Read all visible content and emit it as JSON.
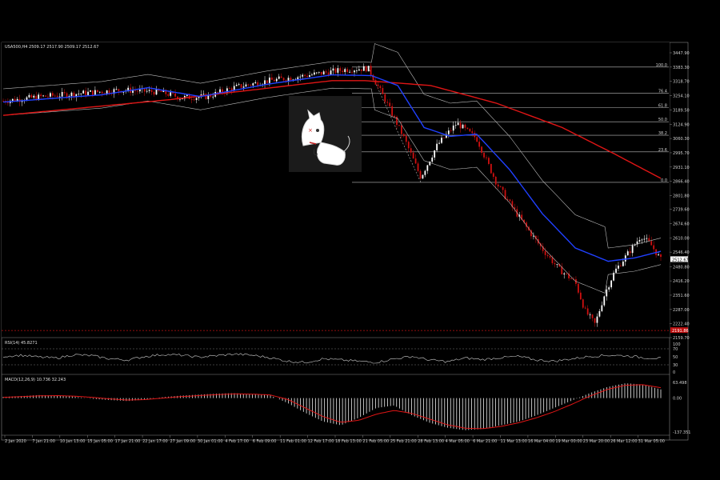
{
  "chart_data": [
    {
      "type": "candlestick",
      "symbol_header": "USA500,H4",
      "ohlc_header": "2509.17 2517.90 2509.17 2512.67",
      "price_axis_ticks": [
        3447.9,
        3383.3,
        3318.7,
        3254.1,
        3189.5,
        3124.9,
        3060.3,
        2995.7,
        2931.1,
        2866.4,
        2801.8,
        2739.6,
        2674.6,
        2610.0,
        2546.4,
        2480.8,
        2416.2,
        2351.6,
        2287.0,
        2222.4,
        2159.7
      ],
      "ylim": [
        2159.7,
        3447.9
      ],
      "current_price_label": "2512.67",
      "current_price": 2512.67,
      "low_line_label": "2191.86",
      "low_line": 2191.86,
      "fibonacci": {
        "levels": [
          {
            "label": "100.0",
            "price": 3383.3
          },
          {
            "label": "76.4",
            "price": 3265.0
          },
          {
            "label": "61.8",
            "price": 3200.0
          },
          {
            "label": "50.0",
            "price": 3136.0
          },
          {
            "label": "38.2",
            "price": 3075.0
          },
          {
            "label": "23.6",
            "price": 3000.0
          },
          {
            "label": "0.0",
            "price": 2862.0
          }
        ]
      },
      "x_axis_labels": [
        "2 Jan 2020",
        "7 Jan 21:00",
        "10 Jan 13:00",
        "15 Jan 05:00",
        "17 Jan 21:00",
        "22 Jan 17:00",
        "27 Jan 09:00",
        "30 Jan 01:00",
        "4 Feb 17:00",
        "6 Feb 09:00",
        "11 Feb 01:00",
        "12 Feb 17:00",
        "18 Feb 13:00",
        "21 Feb 05:00",
        "25 Feb 21:00",
        "28 Feb 13:00",
        "4 Mar 05:00",
        "6 Mar 21:00",
        "11 Mar 13:00",
        "16 Mar 04:00",
        "19 Mar 00:00",
        "23 Mar 20:00",
        "26 Mar 12:00",
        "31 Mar 05:00"
      ],
      "close_trajectory": [
        {
          "t": 0,
          "price": 3230
        },
        {
          "t": 0.06,
          "price": 3250
        },
        {
          "t": 0.12,
          "price": 3265
        },
        {
          "t": 0.18,
          "price": 3280
        },
        {
          "t": 0.24,
          "price": 3270
        },
        {
          "t": 0.27,
          "price": 3245
        },
        {
          "t": 0.31,
          "price": 3250
        },
        {
          "t": 0.35,
          "price": 3290
        },
        {
          "t": 0.4,
          "price": 3320
        },
        {
          "t": 0.46,
          "price": 3345
        },
        {
          "t": 0.52,
          "price": 3372
        },
        {
          "t": 0.555,
          "price": 3378
        },
        {
          "t": 0.58,
          "price": 3240
        },
        {
          "t": 0.61,
          "price": 3060
        },
        {
          "t": 0.635,
          "price": 2885
        },
        {
          "t": 0.66,
          "price": 3030
        },
        {
          "t": 0.69,
          "price": 3130
        },
        {
          "t": 0.72,
          "price": 3060
        },
        {
          "t": 0.75,
          "price": 2860
        },
        {
          "t": 0.775,
          "price": 2745
        },
        {
          "t": 0.8,
          "price": 2640
        },
        {
          "t": 0.82,
          "price": 2560
        },
        {
          "t": 0.845,
          "price": 2470
        },
        {
          "t": 0.87,
          "price": 2410
        },
        {
          "t": 0.885,
          "price": 2280
        },
        {
          "t": 0.9,
          "price": 2220
        },
        {
          "t": 0.915,
          "price": 2360
        },
        {
          "t": 0.93,
          "price": 2460
        },
        {
          "t": 0.95,
          "price": 2540
        },
        {
          "t": 0.97,
          "price": 2620
        },
        {
          "t": 0.985,
          "price": 2580
        },
        {
          "t": 1.0,
          "price": 2512
        }
      ],
      "moving_average_red": [
        {
          "t": 0,
          "price": 3165
        },
        {
          "t": 0.25,
          "price": 3235
        },
        {
          "t": 0.5,
          "price": 3322
        },
        {
          "t": 0.55,
          "price": 3322
        },
        {
          "t": 0.65,
          "price": 3300
        },
        {
          "t": 0.75,
          "price": 3220
        },
        {
          "t": 0.85,
          "price": 3110
        },
        {
          "t": 0.93,
          "price": 2990
        },
        {
          "t": 1.0,
          "price": 2880
        }
      ],
      "moving_average_blue": [
        {
          "t": 0,
          "price": 3225
        },
        {
          "t": 0.15,
          "price": 3258
        },
        {
          "t": 0.22,
          "price": 3290
        },
        {
          "t": 0.3,
          "price": 3250
        },
        {
          "t": 0.4,
          "price": 3305
        },
        {
          "t": 0.5,
          "price": 3348
        },
        {
          "t": 0.56,
          "price": 3345
        },
        {
          "t": 0.6,
          "price": 3300
        },
        {
          "t": 0.64,
          "price": 3110
        },
        {
          "t": 0.68,
          "price": 3070
        },
        {
          "t": 0.72,
          "price": 3080
        },
        {
          "t": 0.77,
          "price": 2920
        },
        {
          "t": 0.82,
          "price": 2720
        },
        {
          "t": 0.87,
          "price": 2565
        },
        {
          "t": 0.92,
          "price": 2505
        },
        {
          "t": 0.96,
          "price": 2520
        },
        {
          "t": 1.0,
          "price": 2550
        }
      ],
      "rsi": {
        "label": "RSI(14) 45.8271",
        "levels": [
          70,
          30
        ],
        "tick_labels": [
          "100",
          "70",
          "50",
          "30",
          "0"
        ],
        "values": [
          55,
          60,
          52,
          48,
          62,
          58,
          45,
          40,
          55,
          63,
          60,
          52,
          58,
          65,
          60,
          50,
          35,
          30,
          45,
          40,
          35,
          30,
          45,
          55,
          40,
          33,
          48,
          42,
          50,
          55,
          40,
          35,
          45,
          55,
          60,
          58,
          50,
          46
        ]
      },
      "macd": {
        "label": "MACD(12,26,9) 10.736 32.243",
        "tick_labels": [
          "63.498",
          "0.00",
          "-137.351"
        ],
        "ylim": [
          -137.351,
          63.498
        ],
        "histogram": [
          5,
          8,
          12,
          10,
          6,
          -3,
          -8,
          -12,
          -6,
          4,
          10,
          14,
          18,
          20,
          16,
          12,
          -20,
          -60,
          -95,
          -110,
          -80,
          -40,
          -30,
          -70,
          -100,
          -120,
          -130,
          -125,
          -110,
          -95,
          -70,
          -40,
          -10,
          20,
          45,
          60,
          55,
          35
        ],
        "signal": [
          3,
          6,
          9,
          10,
          8,
          3,
          -3,
          -8,
          -6,
          0,
          6,
          10,
          14,
          17,
          16,
          13,
          -5,
          -40,
          -75,
          -98,
          -90,
          -65,
          -50,
          -62,
          -85,
          -108,
          -122,
          -124,
          -115,
          -100,
          -80,
          -55,
          -25,
          8,
          35,
          52,
          54,
          42
        ]
      },
      "watermark_present": true
    }
  ]
}
